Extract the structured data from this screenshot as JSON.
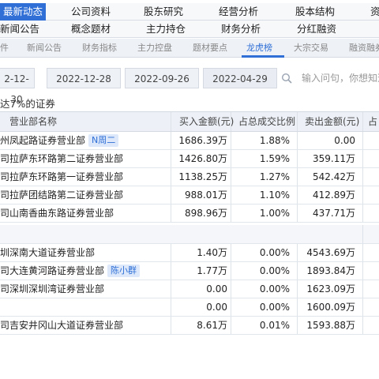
{
  "nav": {
    "row1": [
      "最新动态",
      "公司资料",
      "股东研究",
      "经营分析",
      "股本结构",
      "资"
    ],
    "row2": [
      "新闻公告",
      "概念题材",
      "主力持仓",
      "财务分析",
      "分红融资"
    ]
  },
  "subnav": [
    "件",
    "新闻公告",
    "财务指标",
    "主力控盘",
    "题材要点",
    "龙虎榜",
    "大宗交易",
    "融资融券"
  ],
  "dates": [
    "2-12-30",
    "2022-12-28",
    "2022-09-26",
    "2022-04-29"
  ],
  "search": {
    "placeholder": "输入问句，你想知道的"
  },
  "section_title": "达7%的证券",
  "columns": [
    "营业部名称",
    "买入金额(元)",
    "占总成交比例",
    "卖出金额(元)",
    "占"
  ],
  "buy_rows": [
    {
      "name": "州凤起路证券营业部",
      "tag": "N周二",
      "buy": "1686.39万",
      "pct": "1.88%",
      "sell": "0.00"
    },
    {
      "name": "司拉萨东环路第二证券营业部",
      "tag": "",
      "buy": "1426.80万",
      "pct": "1.59%",
      "sell": "359.11万"
    },
    {
      "name": "司拉萨东环路第一证券营业部",
      "tag": "",
      "buy": "1138.25万",
      "pct": "1.27%",
      "sell": "542.42万"
    },
    {
      "name": "司拉萨团结路第二证券营业部",
      "tag": "",
      "buy": "988.01万",
      "pct": "1.10%",
      "sell": "412.89万"
    },
    {
      "name": "司山南香曲东路证券营业部",
      "tag": "",
      "buy": "898.96万",
      "pct": "1.00%",
      "sell": "437.71万"
    }
  ],
  "sell_rows": [
    {
      "name": "圳深南大道证券营业部",
      "tag": "",
      "buy": "1.40万",
      "pct": "0.00%",
      "sell": "4543.69万"
    },
    {
      "name": "司大连黄河路证券营业部",
      "tag": "陈小群",
      "buy": "1.77万",
      "pct": "0.00%",
      "sell": "1893.84万"
    },
    {
      "name": "司深圳深圳湾证券营业部",
      "tag": "",
      "buy": "0.00",
      "pct": "0.00%",
      "sell": "1623.09万"
    },
    {
      "name": "",
      "tag": "",
      "buy": "0.00",
      "pct": "0.00%",
      "sell": "1600.09万"
    },
    {
      "name": "司吉安井冈山大道证券营业部",
      "tag": "",
      "buy": "8.61万",
      "pct": "0.01%",
      "sell": "1593.88万"
    }
  ],
  "colors": {
    "accent": "#2f6fd6",
    "header_bg": "#edf1f7",
    "badge_bg": "#dde9fb"
  }
}
